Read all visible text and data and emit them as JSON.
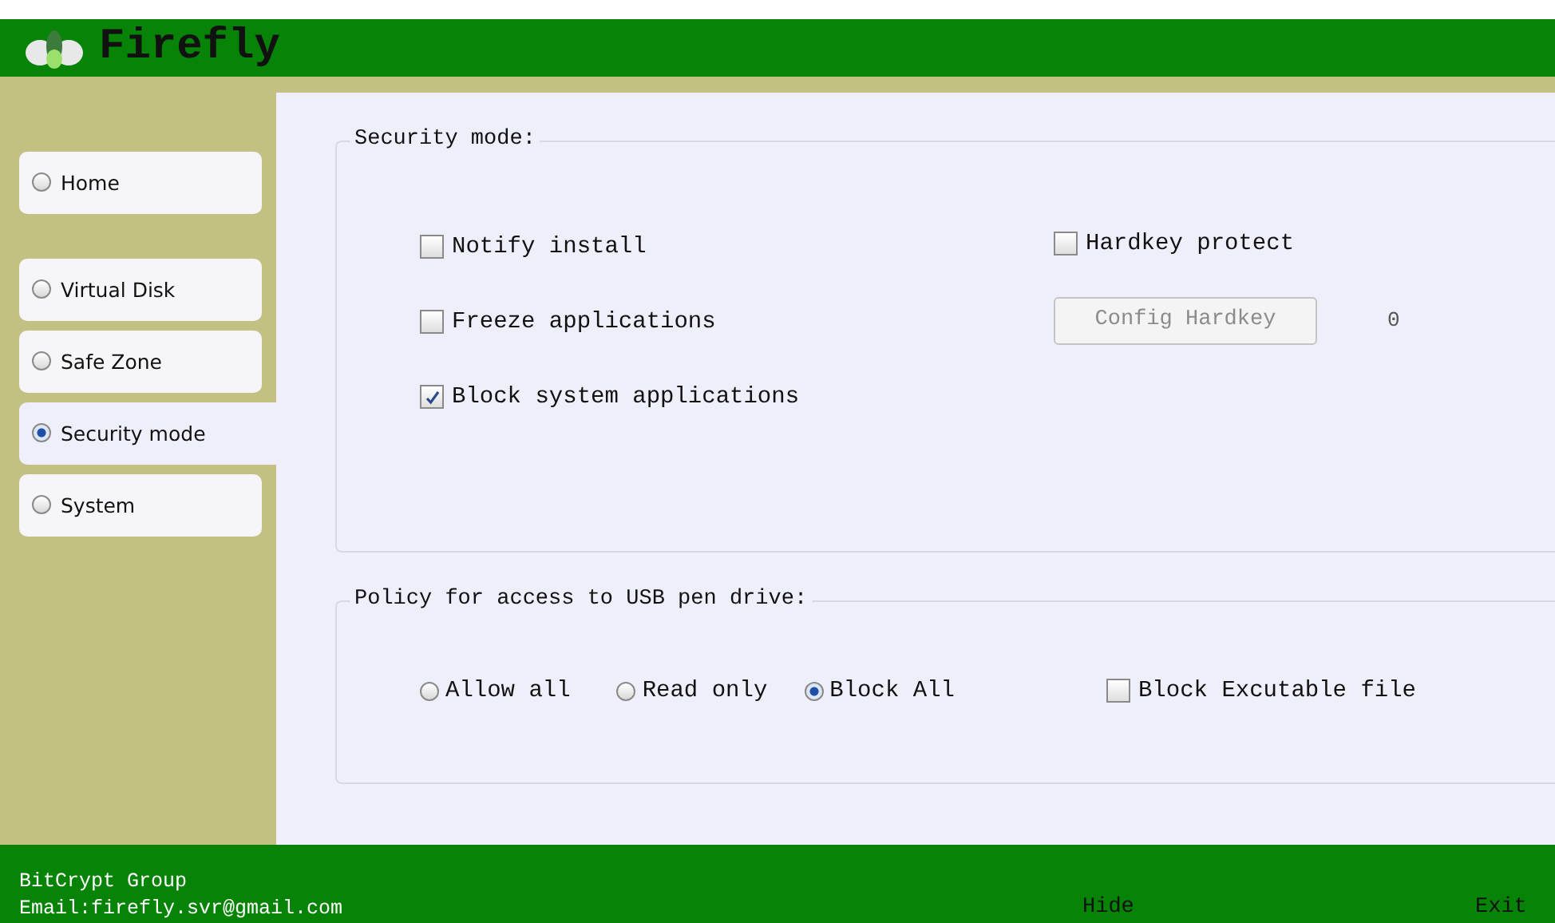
{
  "header": {
    "title": "Firefly"
  },
  "sidebar": {
    "items": [
      {
        "label": "Home",
        "selected": false
      },
      {
        "label": "Virtual Disk",
        "selected": false
      },
      {
        "label": "Safe Zone",
        "selected": false
      },
      {
        "label": "Security mode",
        "selected": true
      },
      {
        "label": "System",
        "selected": false
      }
    ]
  },
  "security": {
    "legend": "Security mode:",
    "options": [
      {
        "label": "Notify install",
        "checked": false
      },
      {
        "label": "Freeze applications",
        "checked": false
      },
      {
        "label": "Block system applications",
        "checked": true
      }
    ],
    "hardkey": {
      "label": "Hardkey protect",
      "checked": false
    },
    "config_button": {
      "label": "Config Hardkey",
      "disabled": true
    },
    "count": "0"
  },
  "usb_policy": {
    "legend": "Policy for access to USB pen drive:",
    "choices": [
      {
        "label": "Allow all",
        "selected": false
      },
      {
        "label": "Read only",
        "selected": false
      },
      {
        "label": "Block All",
        "selected": true
      }
    ],
    "block_exec": {
      "label": "Block Excutable file",
      "checked": false
    }
  },
  "footer": {
    "company": "BitCrypt Group",
    "email": "Email:firefly.svr@gmail.com",
    "hide": "Hide",
    "exit": "Exit"
  }
}
